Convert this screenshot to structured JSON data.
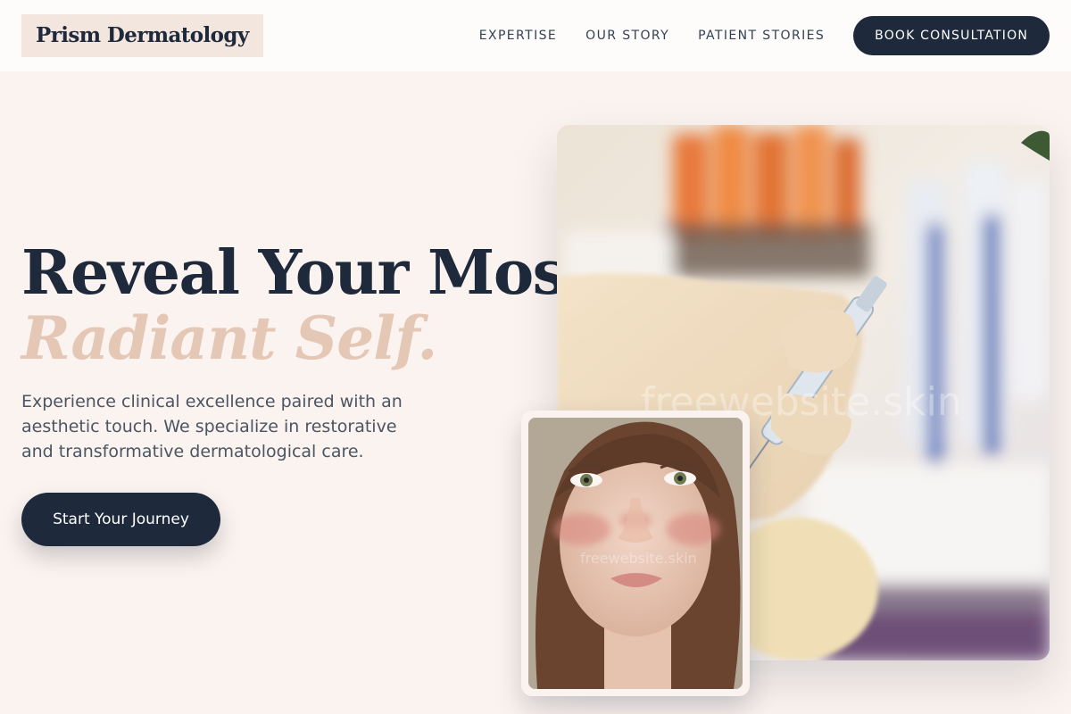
{
  "header": {
    "brand": "Prism Dermatology",
    "nav": [
      {
        "label": "EXPERTISE"
      },
      {
        "label": "OUR STORY"
      },
      {
        "label": "PATIENT STORIES"
      }
    ],
    "cta_label": "BOOK CONSULTATION"
  },
  "hero": {
    "headline_line1": "Reveal Your Most",
    "headline_line2": "Radiant Self.",
    "subtitle": "Experience clinical excellence paired with an aesthetic touch. We specialize in restorative and transformative dermatological care.",
    "cta_label": "Start Your Journey"
  },
  "images": {
    "main_watermark": "freewebsite.skin",
    "portrait_watermark": "freewebsite.skin"
  },
  "colors": {
    "navy": "#1e293b",
    "accent_beige": "#e4c7b5",
    "background": "#fbf3ef"
  },
  "icons": [
    "main-photo",
    "portrait-photo"
  ]
}
